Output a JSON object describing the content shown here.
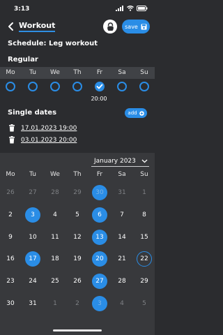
{
  "status": {
    "time": "3:13"
  },
  "nav": {
    "title": "Workout",
    "save_label": "save"
  },
  "schedule": {
    "title": "Schedule: Leg workout"
  },
  "regular": {
    "title": "Regular",
    "weekdays": [
      "Mo",
      "Tu",
      "We",
      "Th",
      "Fr",
      "Sa",
      "Su"
    ],
    "selected_day": "Fr",
    "friday_time": "20:00"
  },
  "single_dates": {
    "title": "Single dates",
    "add_label": "add",
    "items": [
      "17.01.2023 19:00",
      "03.01.2023 20:00"
    ]
  },
  "calendar": {
    "month_label": "January 2023",
    "weekday_headers": [
      "Mo",
      "Tu",
      "We",
      "Th",
      "Fr",
      "Sa",
      "Su"
    ],
    "weeks": [
      [
        {
          "d": "26",
          "s": "muted"
        },
        {
          "d": "27",
          "s": "muted"
        },
        {
          "d": "28",
          "s": "muted"
        },
        {
          "d": "29",
          "s": "muted"
        },
        {
          "d": "30",
          "s": "selected-muted"
        },
        {
          "d": "31",
          "s": "muted"
        },
        {
          "d": "1",
          "s": "muted"
        }
      ],
      [
        {
          "d": "2",
          "s": "normal"
        },
        {
          "d": "3",
          "s": "selected"
        },
        {
          "d": "4",
          "s": "normal"
        },
        {
          "d": "5",
          "s": "normal"
        },
        {
          "d": "6",
          "s": "selected"
        },
        {
          "d": "7",
          "s": "normal"
        },
        {
          "d": "8",
          "s": "normal"
        }
      ],
      [
        {
          "d": "9",
          "s": "normal"
        },
        {
          "d": "10",
          "s": "normal"
        },
        {
          "d": "11",
          "s": "normal"
        },
        {
          "d": "12",
          "s": "normal"
        },
        {
          "d": "13",
          "s": "selected"
        },
        {
          "d": "14",
          "s": "normal"
        },
        {
          "d": "15",
          "s": "normal"
        }
      ],
      [
        {
          "d": "16",
          "s": "normal"
        },
        {
          "d": "17",
          "s": "selected"
        },
        {
          "d": "18",
          "s": "normal"
        },
        {
          "d": "19",
          "s": "normal"
        },
        {
          "d": "20",
          "s": "selected"
        },
        {
          "d": "21",
          "s": "normal"
        },
        {
          "d": "22",
          "s": "today"
        }
      ],
      [
        {
          "d": "23",
          "s": "normal"
        },
        {
          "d": "24",
          "s": "normal"
        },
        {
          "d": "25",
          "s": "normal"
        },
        {
          "d": "26",
          "s": "normal"
        },
        {
          "d": "27",
          "s": "selected"
        },
        {
          "d": "28",
          "s": "normal"
        },
        {
          "d": "29",
          "s": "normal"
        }
      ],
      [
        {
          "d": "30",
          "s": "normal"
        },
        {
          "d": "31",
          "s": "normal"
        },
        {
          "d": "1",
          "s": "muted"
        },
        {
          "d": "2",
          "s": "muted"
        },
        {
          "d": "3",
          "s": "selected-muted"
        },
        {
          "d": "4",
          "s": "muted"
        },
        {
          "d": "5",
          "s": "muted"
        }
      ]
    ]
  },
  "colors": {
    "accent": "#2a8de6",
    "background": "#2b2c2f",
    "header_band": "#404246",
    "calendar_bg": "#38393c"
  },
  "icons": [
    "back-icon",
    "kettlebell-icon",
    "save-icon",
    "checkmark-icon",
    "plus-icon",
    "trash-icon",
    "chevron-down-icon",
    "signal-icon",
    "wifi-icon",
    "battery-icon"
  ]
}
